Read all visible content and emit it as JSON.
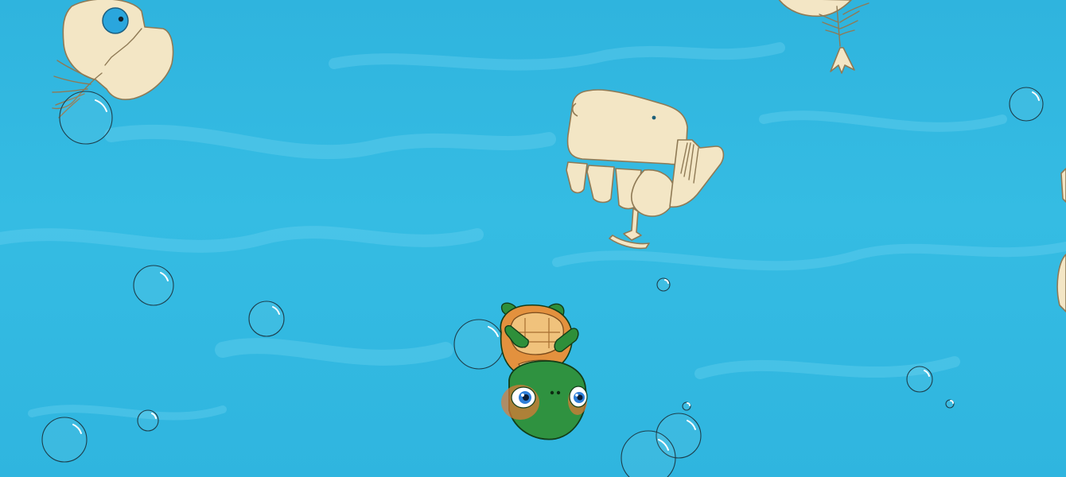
{
  "scene": {
    "water_color": "#2fb4de",
    "caustic_color": "#6fd3f0",
    "bone_color": "#f3e6c5",
    "eye_color": "#2aa6dd"
  },
  "player": {
    "character": "turtle-icon",
    "shell_color": "#2e8f3a",
    "belly_color": "#f0b86a",
    "eye_color": "#2f7ed8"
  },
  "hazards": [
    {
      "type": "fish-skeleton-icon",
      "count": 2
    },
    {
      "type": "whale-skull-icon",
      "count": 1
    },
    {
      "type": "partial-skeleton-icon",
      "count": 1
    }
  ],
  "bubbles": {
    "type": "bubble-icon",
    "count": 14
  }
}
